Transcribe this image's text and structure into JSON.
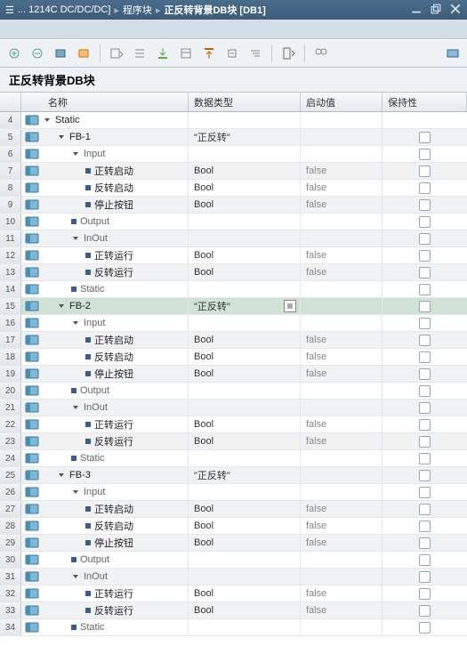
{
  "title": {
    "prefix": "... 1214C DC/DC/DC]",
    "crumb2": "程序块",
    "crumb3": "正反转背景DB块 [DB1]"
  },
  "block_name": "正反转背景DB块",
  "columns": {
    "name": "名称",
    "type": "数据类型",
    "start": "启动值",
    "retain": "保持性"
  },
  "rows": [
    {
      "n": 4,
      "lvl": 0,
      "kind": "expand",
      "icon": "db",
      "name": "Static",
      "type": "",
      "start": "",
      "chk": false
    },
    {
      "n": 5,
      "lvl": 1,
      "kind": "expand",
      "icon": "db",
      "name": "FB-1",
      "type": "\"正反转\"",
      "start": "",
      "chk": true,
      "gray": false
    },
    {
      "n": 6,
      "lvl": 2,
      "kind": "expand",
      "icon": "db",
      "name": "Input",
      "type": "",
      "start": "",
      "chk": true,
      "dim": true
    },
    {
      "n": 7,
      "lvl": 3,
      "kind": "bullet",
      "icon": "db",
      "name": "正转启动",
      "type": "Bool",
      "start": "false",
      "chk": true
    },
    {
      "n": 8,
      "lvl": 3,
      "kind": "bullet",
      "icon": "db",
      "name": "反转启动",
      "type": "Bool",
      "start": "false",
      "chk": true
    },
    {
      "n": 9,
      "lvl": 3,
      "kind": "bullet",
      "icon": "db",
      "name": "停止按钮",
      "type": "Bool",
      "start": "false",
      "chk": true
    },
    {
      "n": 10,
      "lvl": 2,
      "kind": "bullet",
      "icon": "db",
      "name": "Output",
      "type": "",
      "start": "",
      "chk": true,
      "dim": true
    },
    {
      "n": 11,
      "lvl": 2,
      "kind": "expand",
      "icon": "db",
      "name": "InOut",
      "type": "",
      "start": "",
      "chk": true,
      "dim": true
    },
    {
      "n": 12,
      "lvl": 3,
      "kind": "bullet",
      "icon": "db",
      "name": "正转运行",
      "type": "Bool",
      "start": "false",
      "chk": true
    },
    {
      "n": 13,
      "lvl": 3,
      "kind": "bullet",
      "icon": "db",
      "name": "反转运行",
      "type": "Bool",
      "start": "false",
      "chk": true
    },
    {
      "n": 14,
      "lvl": 2,
      "kind": "bullet",
      "icon": "db",
      "name": "Static",
      "type": "",
      "start": "",
      "chk": true,
      "dim": true
    },
    {
      "n": 15,
      "lvl": 1,
      "kind": "expand",
      "icon": "db",
      "name": "FB-2",
      "type": "\"正反转\"",
      "start": "",
      "chk": true,
      "sel": true,
      "dd": true
    },
    {
      "n": 16,
      "lvl": 2,
      "kind": "expand",
      "icon": "db",
      "name": "Input",
      "type": "",
      "start": "",
      "chk": true,
      "dim": true
    },
    {
      "n": 17,
      "lvl": 3,
      "kind": "bullet",
      "icon": "db",
      "name": "正转启动",
      "type": "Bool",
      "start": "false",
      "chk": true
    },
    {
      "n": 18,
      "lvl": 3,
      "kind": "bullet",
      "icon": "db",
      "name": "反转启动",
      "type": "Bool",
      "start": "false",
      "chk": true
    },
    {
      "n": 19,
      "lvl": 3,
      "kind": "bullet",
      "icon": "db",
      "name": "停止按钮",
      "type": "Bool",
      "start": "false",
      "chk": true
    },
    {
      "n": 20,
      "lvl": 2,
      "kind": "bullet",
      "icon": "db",
      "name": "Output",
      "type": "",
      "start": "",
      "chk": true,
      "dim": true
    },
    {
      "n": 21,
      "lvl": 2,
      "kind": "expand",
      "icon": "db",
      "name": "InOut",
      "type": "",
      "start": "",
      "chk": true,
      "dim": true
    },
    {
      "n": 22,
      "lvl": 3,
      "kind": "bullet",
      "icon": "db",
      "name": "正转运行",
      "type": "Bool",
      "start": "false",
      "chk": true
    },
    {
      "n": 23,
      "lvl": 3,
      "kind": "bullet",
      "icon": "db",
      "name": "反转运行",
      "type": "Bool",
      "start": "false",
      "chk": true
    },
    {
      "n": 24,
      "lvl": 2,
      "kind": "bullet",
      "icon": "db",
      "name": "Static",
      "type": "",
      "start": "",
      "chk": true,
      "dim": true
    },
    {
      "n": 25,
      "lvl": 1,
      "kind": "expand",
      "icon": "db",
      "name": "FB-3",
      "type": "\"正反转\"",
      "start": "",
      "chk": true
    },
    {
      "n": 26,
      "lvl": 2,
      "kind": "expand",
      "icon": "db",
      "name": "Input",
      "type": "",
      "start": "",
      "chk": true,
      "dim": true
    },
    {
      "n": 27,
      "lvl": 3,
      "kind": "bullet",
      "icon": "db",
      "name": "正转启动",
      "type": "Bool",
      "start": "false",
      "chk": true
    },
    {
      "n": 28,
      "lvl": 3,
      "kind": "bullet",
      "icon": "db",
      "name": "反转启动",
      "type": "Bool",
      "start": "false",
      "chk": true
    },
    {
      "n": 29,
      "lvl": 3,
      "kind": "bullet",
      "icon": "db",
      "name": "停止按钮",
      "type": "Bool",
      "start": "false",
      "chk": true
    },
    {
      "n": 30,
      "lvl": 2,
      "kind": "bullet",
      "icon": "db",
      "name": "Output",
      "type": "",
      "start": "",
      "chk": true,
      "dim": true
    },
    {
      "n": 31,
      "lvl": 2,
      "kind": "expand",
      "icon": "db",
      "name": "InOut",
      "type": "",
      "start": "",
      "chk": true,
      "dim": true
    },
    {
      "n": 32,
      "lvl": 3,
      "kind": "bullet",
      "icon": "db",
      "name": "正转运行",
      "type": "Bool",
      "start": "false",
      "chk": true
    },
    {
      "n": 33,
      "lvl": 3,
      "kind": "bullet",
      "icon": "db",
      "name": "反转运行",
      "type": "Bool",
      "start": "false",
      "chk": true
    },
    {
      "n": 34,
      "lvl": 2,
      "kind": "bullet",
      "icon": "db",
      "name": "Static",
      "type": "",
      "start": "",
      "chk": true,
      "dim": true
    }
  ]
}
